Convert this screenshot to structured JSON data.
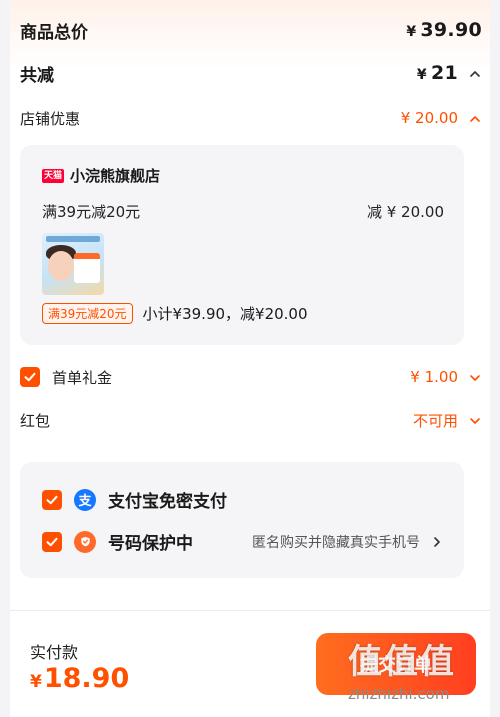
{
  "summary": {
    "total_label": "商品总价",
    "total_currency": "¥",
    "total_value": "39.90",
    "reduce_label": "共减",
    "reduce_currency": "¥",
    "reduce_value": "21",
    "shop_discount_label": "店铺优惠",
    "shop_discount_value": "¥ 20.00"
  },
  "shop": {
    "badge": "天猫",
    "name": "小浣熊旗舰店",
    "promo_text": "满39元减20元",
    "promo_reduce": "减 ¥ 20.00",
    "promo_tag": "满39元减20元",
    "subtotal_text": "小计¥39.90，减¥20.00"
  },
  "gift": {
    "label": "首单礼金",
    "value": "¥ 1.00"
  },
  "redpacket": {
    "label": "红包",
    "value": "不可用"
  },
  "payment": {
    "alipay_icon": "支",
    "alipay_label": "支付宝免密支付",
    "privacy_label": "号码保护中",
    "privacy_hint": "匿名购买并隐藏真实手机号"
  },
  "footer": {
    "paid_label": "实付款",
    "paid_currency": "¥",
    "paid_value": "18.90",
    "submit_label": "提交订单",
    "watermark_big": "值值值",
    "watermark_small": "zhizhizhi.com"
  },
  "colors": {
    "accent": "#ff5000",
    "alipay": "#1677ff"
  },
  "icons": [
    "chevron-up-icon",
    "chevron-down-icon",
    "check-icon",
    "alipay-icon",
    "shield-icon",
    "chevron-right-icon"
  ]
}
